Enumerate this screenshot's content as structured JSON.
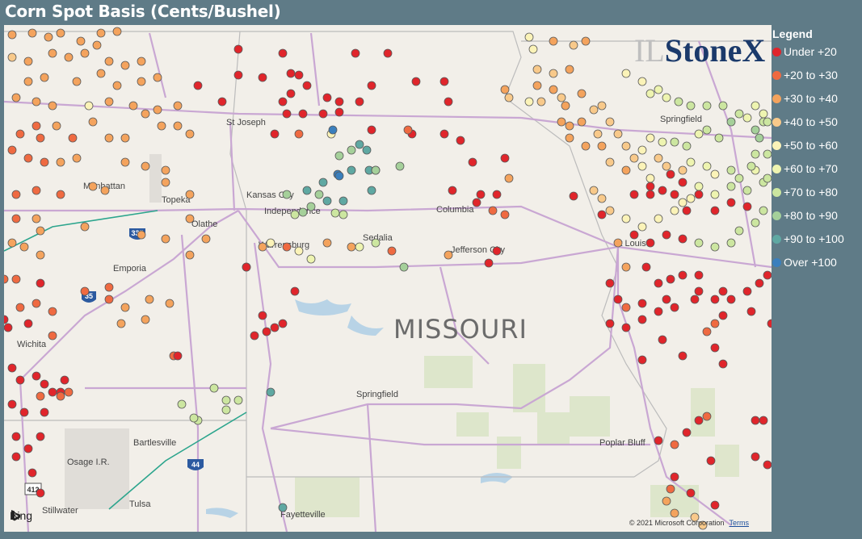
{
  "title": "Corn Spot Basis (Cents/Bushel)",
  "legend": {
    "title": "Legend",
    "items": [
      {
        "label": "Under +20",
        "color": "#e0252b"
      },
      {
        "label": "+20 to +30",
        "color": "#ef6a41"
      },
      {
        "label": "+30 to +40",
        "color": "#f4a35d"
      },
      {
        "label": "+40 to +50",
        "color": "#f8c98a"
      },
      {
        "label": "+50 to +60",
        "color": "#fbf3b8"
      },
      {
        "label": "+60 to +70",
        "color": "#eef4b0"
      },
      {
        "label": "+70 to +80",
        "color": "#cce6a0"
      },
      {
        "label": "+80 to +90",
        "color": "#a5d09a"
      },
      {
        "label": "+90 to +100",
        "color": "#5fa8a2"
      },
      {
        "label": "Over +100",
        "color": "#3a7fbd"
      }
    ]
  },
  "logo": {
    "prefix": "IL",
    "brand": "StoneX"
  },
  "attribution": {
    "provider": "Bing",
    "copyright": "© 2021 Microsoft Corporation",
    "terms": "Terms"
  },
  "map_labels": {
    "state": "MISSOURI",
    "cities": [
      "St Joseph",
      "Manhattan",
      "Topeka",
      "Kansas City",
      "Independence",
      "Olathe",
      "Columbia",
      "Sedalia",
      "Warrensburg",
      "Jefferson City",
      "Emporia",
      "Springfield",
      "St Louis",
      "Wichita",
      "Springfield",
      "Bartlesville",
      "Osage I.R.",
      "Poplar Bluff",
      "Tulsa",
      "Stillwater",
      "Fayetteville"
    ],
    "shields": [
      "335",
      "35",
      "44",
      "412"
    ]
  }
}
